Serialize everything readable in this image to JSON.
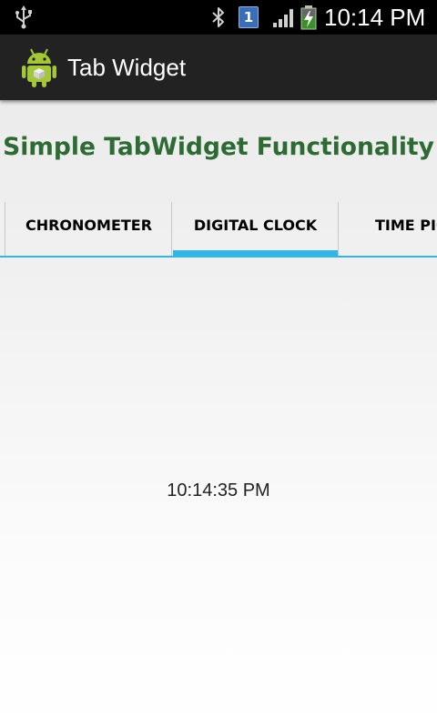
{
  "status_bar": {
    "time": "10:14 PM",
    "notification_count": "1",
    "icons": [
      "usb-icon",
      "bluetooth-icon",
      "notification-badge",
      "signal-icon",
      "battery-charging-icon"
    ]
  },
  "action_bar": {
    "title": "Tab Widget",
    "icon": "android-app-icon"
  },
  "heading": "Simple TabWidget Functionality",
  "tabs": [
    {
      "label": "CHRONOMETER",
      "selected": false
    },
    {
      "label": "DIGITAL CLOCK",
      "selected": true
    },
    {
      "label": "TIME PIC",
      "selected": false
    }
  ],
  "content": {
    "digital_clock": "10:14:35 PM"
  },
  "colors": {
    "heading": "#2e6b34",
    "tab_indicator": "#33b5e5",
    "action_bar": "#222222",
    "status_bar": "#000000"
  }
}
